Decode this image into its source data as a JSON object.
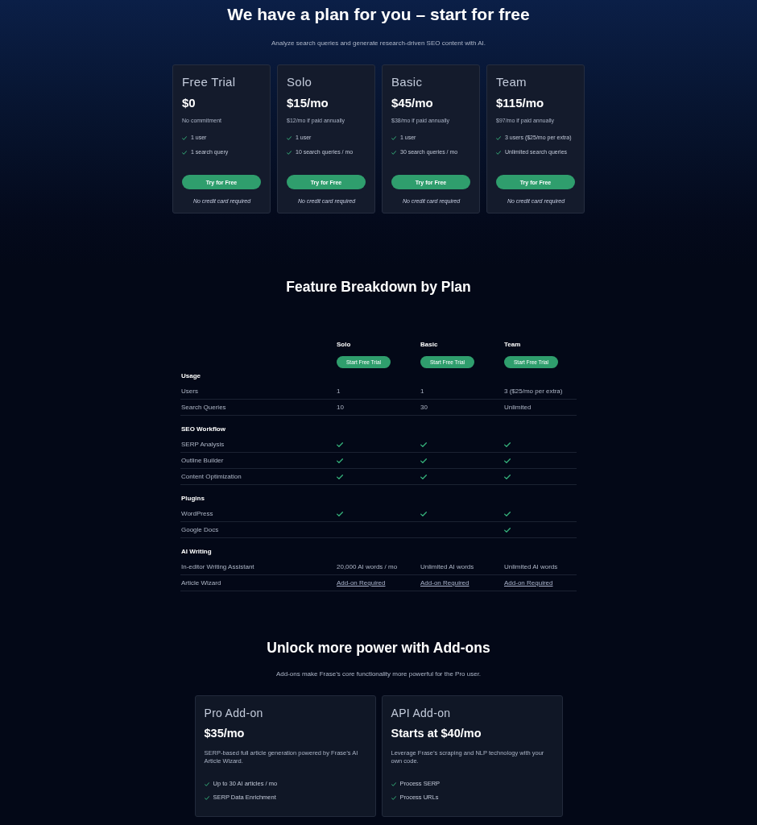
{
  "header": {
    "title": "We have a plan for you – start for free",
    "subtitle": "Analyze search queries and generate research-driven SEO content with AI."
  },
  "plans": [
    {
      "name": "Free Trial",
      "price": "$0",
      "note": "No commitment",
      "features": [
        "1 user",
        "1 search query"
      ],
      "button": "Try for Free",
      "footnote": "No credit card required"
    },
    {
      "name": "Solo",
      "price": "$15/mo",
      "note": "$12/mo if paid annually",
      "features": [
        "1 user",
        "10 search queries / mo"
      ],
      "button": "Try for Free",
      "footnote": "No credit card required"
    },
    {
      "name": "Basic",
      "price": "$45/mo",
      "note": "$38/mo if paid annually",
      "features": [
        "1 user",
        "30 search queries / mo"
      ],
      "button": "Try for Free",
      "footnote": "No credit card required"
    },
    {
      "name": "Team",
      "price": "$115/mo",
      "note": "$97/mo if paid annually",
      "features": [
        "3 users ($25/mo per extra)",
        "Unlimited search queries"
      ],
      "button": "Try for Free",
      "footnote": "No credit card required"
    }
  ],
  "feature_breakdown": {
    "title": "Feature Breakdown by Plan",
    "columns": [
      {
        "name": "Solo",
        "button": "Start Free Trial"
      },
      {
        "name": "Basic",
        "button": "Start Free Trial"
      },
      {
        "name": "Team",
        "button": "Start Free Trial"
      }
    ],
    "groups": [
      {
        "name": "Usage",
        "rows": [
          {
            "label": "Users",
            "cells": [
              {
                "kind": "text",
                "text": "1"
              },
              {
                "kind": "text",
                "text": "1"
              },
              {
                "kind": "text",
                "text": "3 ($25/mo per extra)"
              }
            ]
          },
          {
            "label": "Search Queries",
            "cells": [
              {
                "kind": "text",
                "text": "10"
              },
              {
                "kind": "text",
                "text": "30"
              },
              {
                "kind": "text",
                "text": "Unlimited"
              }
            ]
          }
        ]
      },
      {
        "name": "SEO Workflow",
        "rows": [
          {
            "label": "SERP Analysis",
            "cells": [
              {
                "kind": "check",
                "checked": true
              },
              {
                "kind": "check",
                "checked": true
              },
              {
                "kind": "check",
                "checked": true
              }
            ]
          },
          {
            "label": "Outline Builder",
            "cells": [
              {
                "kind": "check",
                "checked": true
              },
              {
                "kind": "check",
                "checked": true
              },
              {
                "kind": "check",
                "checked": true
              }
            ]
          },
          {
            "label": "Content Optimization",
            "cells": [
              {
                "kind": "check",
                "checked": true
              },
              {
                "kind": "check",
                "checked": true
              },
              {
                "kind": "check",
                "checked": true
              }
            ]
          }
        ]
      },
      {
        "name": "Plugins",
        "rows": [
          {
            "label": "WordPress",
            "cells": [
              {
                "kind": "check",
                "checked": true
              },
              {
                "kind": "check",
                "checked": true
              },
              {
                "kind": "check",
                "checked": true
              }
            ]
          },
          {
            "label": "Google Docs",
            "cells": [
              {
                "kind": "check",
                "checked": false
              },
              {
                "kind": "check",
                "checked": false
              },
              {
                "kind": "check",
                "checked": true
              }
            ]
          }
        ]
      },
      {
        "name": "AI Writing",
        "rows": [
          {
            "label": "In-editor Writing Assistant",
            "cells": [
              {
                "kind": "text",
                "text": "20,000 AI words / mo"
              },
              {
                "kind": "text",
                "text": "Unlimited AI words"
              },
              {
                "kind": "text",
                "text": "Unlimited AI words"
              }
            ]
          },
          {
            "label": "Article Wizard",
            "cells": [
              {
                "kind": "link",
                "text": "Add-on Required"
              },
              {
                "kind": "link",
                "text": "Add-on Required"
              },
              {
                "kind": "link",
                "text": "Add-on Required"
              }
            ]
          }
        ]
      }
    ]
  },
  "addons": {
    "title": "Unlock more power with Add-ons",
    "subtitle": "Add-ons make Frase’s core functionality more powerful for the Pro user.",
    "cards": [
      {
        "name": "Pro Add-on",
        "price": "$35/mo",
        "description": "SERP-based full article generation powered by Frase’s AI Article Wizard.",
        "features": [
          "Up to 30 AI articles / mo",
          "SERP Data Enrichment"
        ]
      },
      {
        "name": "API Add-on",
        "price": "Starts at $40/mo",
        "description": "Leverage Frase’s scraping and NLP technology with your own code.",
        "features": [
          "Process SERP",
          "Process URLs"
        ]
      }
    ]
  }
}
